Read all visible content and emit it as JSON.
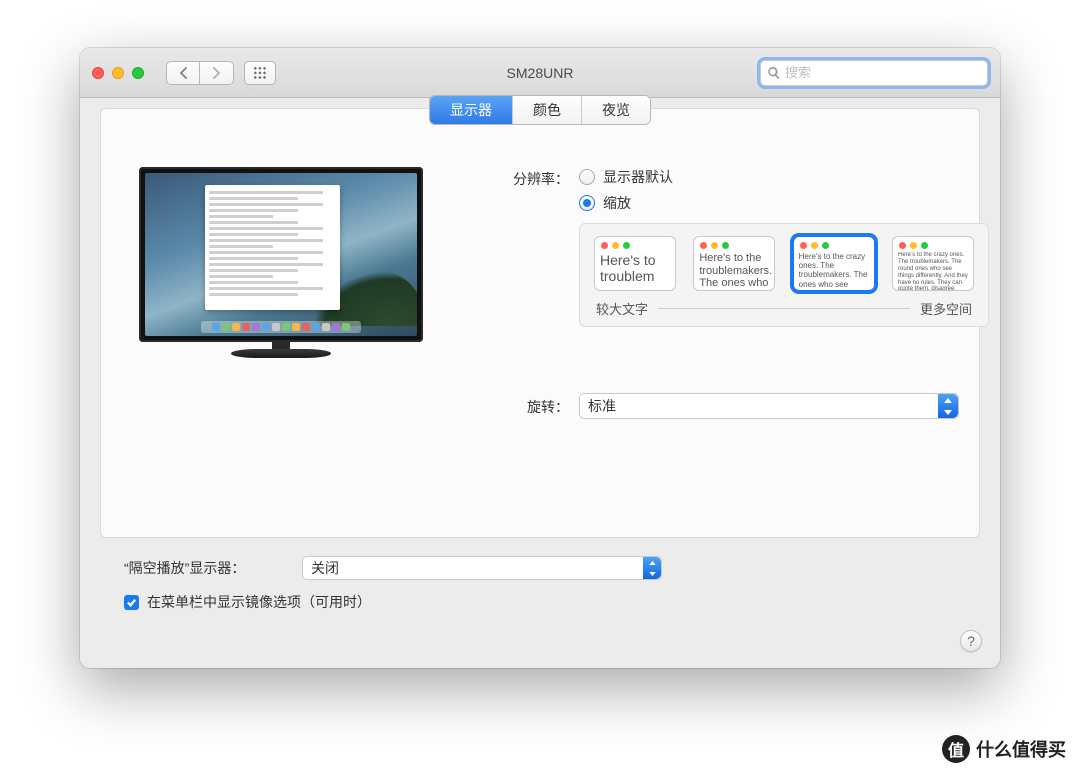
{
  "window": {
    "title": "SM28UNR"
  },
  "search": {
    "placeholder": "搜索"
  },
  "tabs": {
    "display": "显示器",
    "color": "颜色",
    "nightshift": "夜览",
    "selected": 0
  },
  "form": {
    "resolution_label": "分辨率：",
    "radio_default": "显示器默认",
    "radio_scaled": "缩放",
    "radio_selected": "scaled",
    "scale_left_label": "较大文字",
    "scale_right_label": "更多空间",
    "scale_thumbs": [
      {
        "text": "Here's to troublem",
        "font": 14,
        "selected": false
      },
      {
        "text": "Here's to the troublemakers. The ones who",
        "font": 11,
        "selected": false
      },
      {
        "text": "Here's to the crazy ones. The troublemakers. The ones who see things differently. And they",
        "font": 8,
        "selected": true
      },
      {
        "text": "Here’s to the crazy ones. The troublemakers. The round ones who see things differently. And they have no rules. They can quote them, disagree. About the only thing. Because they change th",
        "font": 6,
        "selected": false
      }
    ],
    "rotation_label": "旋转：",
    "rotation_value": "标准"
  },
  "bottom": {
    "airplay_label": "“隔空播放”显示器：",
    "airplay_value": "关闭",
    "mirror_checkbox_label": "在菜单栏中显示镜像选项（可用时）",
    "mirror_checked": true
  },
  "help": "?",
  "watermark": "什么值得买",
  "dock_colors": [
    "#5aa6e6",
    "#7ac778",
    "#f3b74a",
    "#e26565",
    "#9c7ad5",
    "#5aa6e6",
    "#c8c8c8",
    "#7ac778",
    "#f3b74a",
    "#e26565",
    "#5aa6e6",
    "#c8c8c8",
    "#9c7ad5",
    "#7ac778"
  ]
}
